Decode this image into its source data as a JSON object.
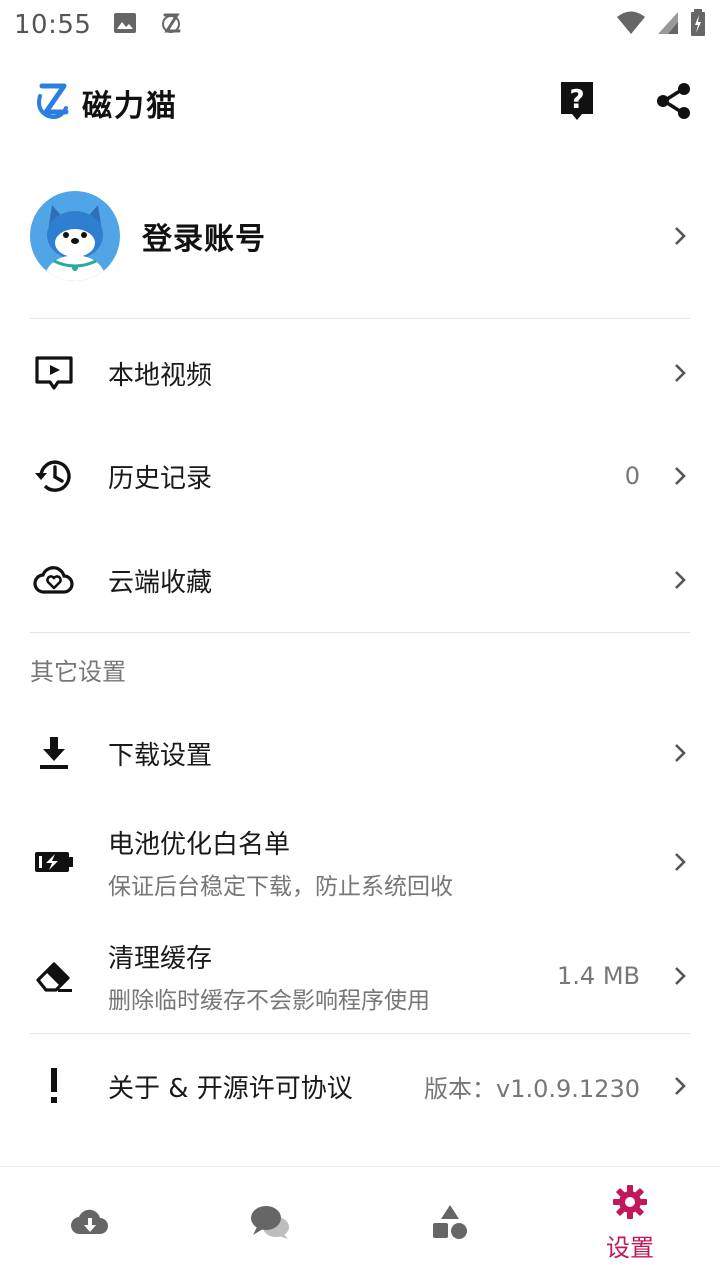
{
  "status_bar": {
    "time": "10:55",
    "icons": [
      "image-icon",
      "app-notification-icon",
      "wifi-icon",
      "signal-icon",
      "battery-icon"
    ]
  },
  "header": {
    "app_name": "磁力猫",
    "logo_color": "#2b7fe0",
    "actions": [
      "help-icon",
      "share-icon"
    ]
  },
  "profile": {
    "label": "登录账号"
  },
  "menu": {
    "local_videos": {
      "label": "本地视频",
      "icon": "video-icon"
    },
    "history": {
      "label": "历史记录",
      "value": "0",
      "icon": "history-icon"
    },
    "cloud_favorites": {
      "label": "云端收藏",
      "icon": "cloud-heart-icon"
    }
  },
  "other_settings": {
    "section_title": "其它设置",
    "download": {
      "label": "下载设置",
      "icon": "download-icon"
    },
    "battery": {
      "label": "电池优化白名单",
      "subtitle": "保证后台稳定下载，防止系统回收",
      "icon": "battery-charge-icon"
    },
    "cache": {
      "label": "清理缓存",
      "subtitle": "删除临时缓存不会影响程序使用",
      "value": "1.4 MB",
      "icon": "eraser-icon"
    },
    "about": {
      "label": "关于 & 开源许可协议",
      "value": "版本：v1.0.9.1230",
      "icon": "exclamation-icon"
    }
  },
  "bottom_nav": {
    "items": [
      {
        "icon": "cloud-download-icon",
        "label": ""
      },
      {
        "icon": "chat-icon",
        "label": ""
      },
      {
        "icon": "shapes-icon",
        "label": ""
      },
      {
        "icon": "gear-icon",
        "label": "设置",
        "active": true
      }
    ],
    "active_color": "#c2185b",
    "inactive_color": "#666666"
  }
}
